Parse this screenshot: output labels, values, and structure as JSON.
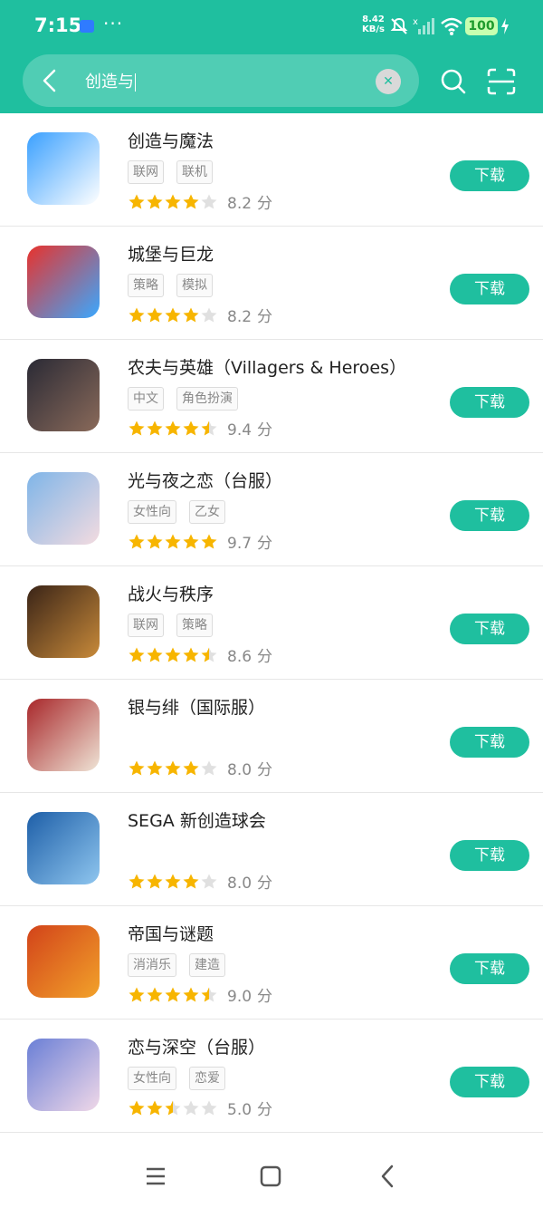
{
  "status_bar": {
    "time": "7:15",
    "speed_value": "8.42",
    "speed_unit": "KB/s",
    "battery": "100"
  },
  "search": {
    "query": "创造与"
  },
  "accent_color": "#1fbf9f",
  "download_label": "下载",
  "score_unit": "分",
  "apps": [
    {
      "name": "创造与魔法",
      "tags": [
        "联网",
        "联机"
      ],
      "stars": 4,
      "score": "8.2",
      "icon": "creation-magic-icon",
      "colors": [
        "#3aa0ff",
        "#ffffff"
      ]
    },
    {
      "name": "城堡与巨龙",
      "tags": [
        "策略",
        "模拟"
      ],
      "stars": 4,
      "score": "8.2",
      "icon": "castle-dragon-icon",
      "colors": [
        "#e8322c",
        "#3aa8ff"
      ]
    },
    {
      "name": "农夫与英雄（Villagers & Heroes）",
      "tags": [
        "中文",
        "角色扮演"
      ],
      "stars": 4.5,
      "score": "9.4",
      "icon": "villagers-heroes-icon",
      "colors": [
        "#2a2a35",
        "#8a6a5a"
      ]
    },
    {
      "name": "光与夜之恋（台服）",
      "tags": [
        "女性向",
        "乙女"
      ],
      "stars": 5,
      "score": "9.7",
      "icon": "light-night-icon",
      "colors": [
        "#7fb5e8",
        "#f3dbe0"
      ]
    },
    {
      "name": "战火与秩序",
      "tags": [
        "联网",
        "策略"
      ],
      "stars": 4.5,
      "score": "8.6",
      "icon": "war-order-icon",
      "colors": [
        "#3a2417",
        "#c88a3a"
      ]
    },
    {
      "name": "银与绯（国际服）",
      "tags": [],
      "stars": 4,
      "score": "8.0",
      "icon": "silver-crimson-icon",
      "colors": [
        "#a8272a",
        "#efe4d6"
      ]
    },
    {
      "name": "SEGA 新创造球会",
      "tags": [],
      "stars": 4,
      "score": "8.0",
      "icon": "sega-football-icon",
      "colors": [
        "#1e5fa8",
        "#8fc6ef"
      ]
    },
    {
      "name": "帝国与谜题",
      "tags": [
        "消消乐",
        "建造"
      ],
      "stars": 4.5,
      "score": "9.0",
      "icon": "empires-puzzles-icon",
      "colors": [
        "#d2431a",
        "#f2a22a"
      ]
    },
    {
      "name": "恋与深空（台服）",
      "tags": [
        "女性向",
        "恋爱"
      ],
      "stars": 2.5,
      "score": "5.0",
      "icon": "love-deepspace-icon",
      "colors": [
        "#6a7fd6",
        "#f0d8e8"
      ]
    }
  ]
}
